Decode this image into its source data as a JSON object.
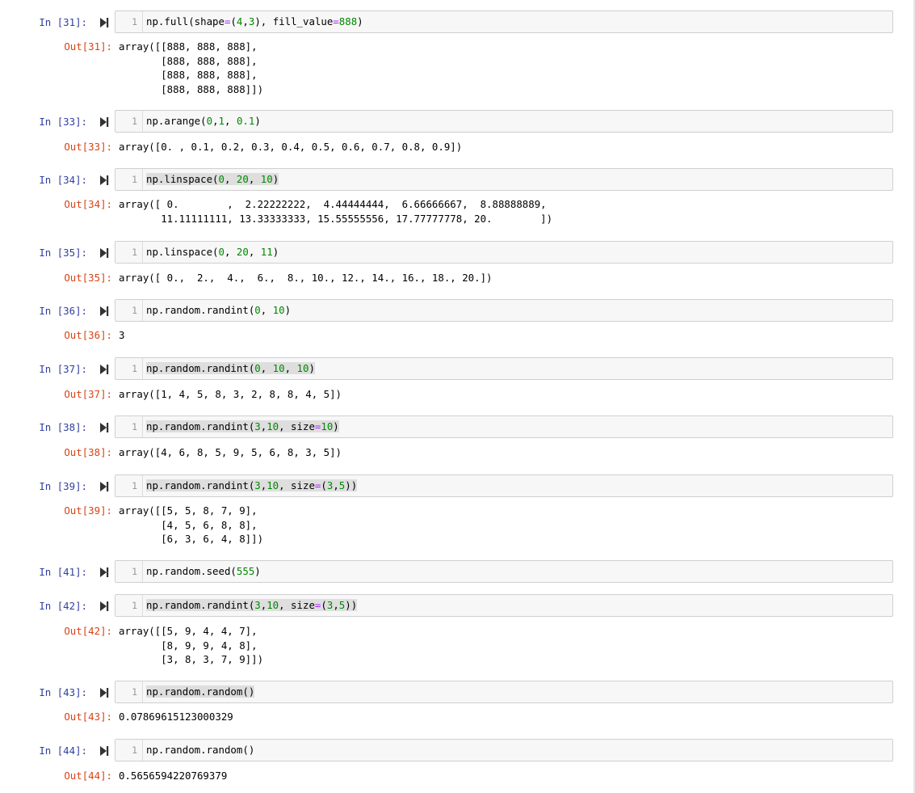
{
  "cells": [
    {
      "id": "c31",
      "in_prompt": "In [31]:",
      "line_no": "1",
      "highlight": false,
      "code": [
        [
          "np.full(shape",
          ""
        ],
        [
          "=",
          "op"
        ],
        [
          "(",
          ""
        ],
        [
          "4",
          "num"
        ],
        [
          ",",
          ""
        ],
        [
          "3",
          "num"
        ],
        [
          "), fill_value",
          ""
        ],
        [
          "=",
          "op"
        ],
        [
          "888",
          "num"
        ],
        [
          ")",
          ""
        ]
      ],
      "out_prompt": "Out[31]:",
      "output": "array([[888, 888, 888],\n       [888, 888, 888],\n       [888, 888, 888],\n       [888, 888, 888]])"
    },
    {
      "id": "c33",
      "in_prompt": "In [33]:",
      "line_no": "1",
      "highlight": false,
      "code": [
        [
          "np.arange(",
          ""
        ],
        [
          "0",
          "num"
        ],
        [
          ",",
          ""
        ],
        [
          "1",
          "num"
        ],
        [
          ", ",
          ""
        ],
        [
          "0.1",
          "num"
        ],
        [
          ")",
          ""
        ]
      ],
      "out_prompt": "Out[33]:",
      "output": "array([0. , 0.1, 0.2, 0.3, 0.4, 0.5, 0.6, 0.7, 0.8, 0.9])"
    },
    {
      "id": "c34",
      "in_prompt": "In [34]:",
      "line_no": "1",
      "highlight": true,
      "code": [
        [
          "np.linspace(",
          ""
        ],
        [
          "0",
          "num"
        ],
        [
          ", ",
          ""
        ],
        [
          "20",
          "num"
        ],
        [
          ", ",
          ""
        ],
        [
          "10",
          "num"
        ],
        [
          ")",
          ""
        ]
      ],
      "out_prompt": "Out[34]:",
      "output": "array([ 0.        ,  2.22222222,  4.44444444,  6.66666667,  8.88888889,\n       11.11111111, 13.33333333, 15.55555556, 17.77777778, 20.        ])"
    },
    {
      "id": "c35",
      "in_prompt": "In [35]:",
      "line_no": "1",
      "highlight": false,
      "code": [
        [
          "np.linspace(",
          ""
        ],
        [
          "0",
          "num"
        ],
        [
          ", ",
          ""
        ],
        [
          "20",
          "num"
        ],
        [
          ", ",
          ""
        ],
        [
          "11",
          "num"
        ],
        [
          ")",
          ""
        ]
      ],
      "out_prompt": "Out[35]:",
      "output": "array([ 0.,  2.,  4.,  6.,  8., 10., 12., 14., 16., 18., 20.])"
    },
    {
      "id": "c36",
      "in_prompt": "In [36]:",
      "line_no": "1",
      "highlight": false,
      "code": [
        [
          "np.random.randint(",
          ""
        ],
        [
          "0",
          "num"
        ],
        [
          ", ",
          ""
        ],
        [
          "10",
          "num"
        ],
        [
          ")",
          ""
        ]
      ],
      "out_prompt": "Out[36]:",
      "output": "3"
    },
    {
      "id": "c37",
      "in_prompt": "In [37]:",
      "line_no": "1",
      "highlight": true,
      "code": [
        [
          "np.random.randint(",
          ""
        ],
        [
          "0",
          "num"
        ],
        [
          ", ",
          ""
        ],
        [
          "10",
          "num"
        ],
        [
          ", ",
          ""
        ],
        [
          "10",
          "num"
        ],
        [
          ")",
          ""
        ]
      ],
      "out_prompt": "Out[37]:",
      "output": "array([1, 4, 5, 8, 3, 2, 8, 8, 4, 5])"
    },
    {
      "id": "c38",
      "in_prompt": "In [38]:",
      "line_no": "1",
      "highlight": true,
      "code": [
        [
          "np.random.randint(",
          ""
        ],
        [
          "3",
          "num"
        ],
        [
          ",",
          ""
        ],
        [
          "10",
          "num"
        ],
        [
          ", size",
          ""
        ],
        [
          "=",
          "op"
        ],
        [
          "10",
          "num"
        ],
        [
          ")",
          ""
        ]
      ],
      "out_prompt": "Out[38]:",
      "output": "array([4, 6, 8, 5, 9, 5, 6, 8, 3, 5])"
    },
    {
      "id": "c39",
      "in_prompt": "In [39]:",
      "line_no": "1",
      "highlight": true,
      "code": [
        [
          "np.random.randint(",
          ""
        ],
        [
          "3",
          "num"
        ],
        [
          ",",
          ""
        ],
        [
          "10",
          "num"
        ],
        [
          ", size",
          ""
        ],
        [
          "=",
          "op"
        ],
        [
          "(",
          ""
        ],
        [
          "3",
          "num"
        ],
        [
          ",",
          ""
        ],
        [
          "5",
          "num"
        ],
        [
          "))",
          ""
        ]
      ],
      "out_prompt": "Out[39]:",
      "output": "array([[5, 5, 8, 7, 9],\n       [4, 5, 6, 8, 8],\n       [6, 3, 6, 4, 8]])"
    },
    {
      "id": "c41",
      "in_prompt": "In [41]:",
      "line_no": "1",
      "highlight": false,
      "code": [
        [
          "np.random.seed(",
          ""
        ],
        [
          "555",
          "num"
        ],
        [
          ")",
          ""
        ]
      ],
      "out_prompt": "",
      "output": ""
    },
    {
      "id": "c42",
      "in_prompt": "In [42]:",
      "line_no": "1",
      "highlight": true,
      "code": [
        [
          "np.random.randint(",
          ""
        ],
        [
          "3",
          "num"
        ],
        [
          ",",
          ""
        ],
        [
          "10",
          "num"
        ],
        [
          ", size",
          ""
        ],
        [
          "=",
          "op"
        ],
        [
          "(",
          ""
        ],
        [
          "3",
          "num"
        ],
        [
          ",",
          ""
        ],
        [
          "5",
          "num"
        ],
        [
          "))",
          ""
        ]
      ],
      "out_prompt": "Out[42]:",
      "output": "array([[5, 9, 4, 4, 7],\n       [8, 9, 9, 4, 8],\n       [3, 8, 3, 7, 9]])"
    },
    {
      "id": "c43",
      "in_prompt": "In [43]:",
      "line_no": "1",
      "highlight": true,
      "code": [
        [
          "np.random.random()",
          ""
        ]
      ],
      "out_prompt": "Out[43]:",
      "output": "0.07869615123000329"
    },
    {
      "id": "c44",
      "in_prompt": "In [44]:",
      "line_no": "1",
      "highlight": false,
      "code": [
        [
          "np.random.random()",
          ""
        ]
      ],
      "out_prompt": "Out[44]:",
      "output": "0.5656594220769379"
    }
  ],
  "icons": {
    "run": "run-cell-icon"
  },
  "colors": {
    "in_prompt": "#303f9f",
    "out_prompt": "#d84315",
    "number": "#008800",
    "operator": "#aa22ff"
  }
}
